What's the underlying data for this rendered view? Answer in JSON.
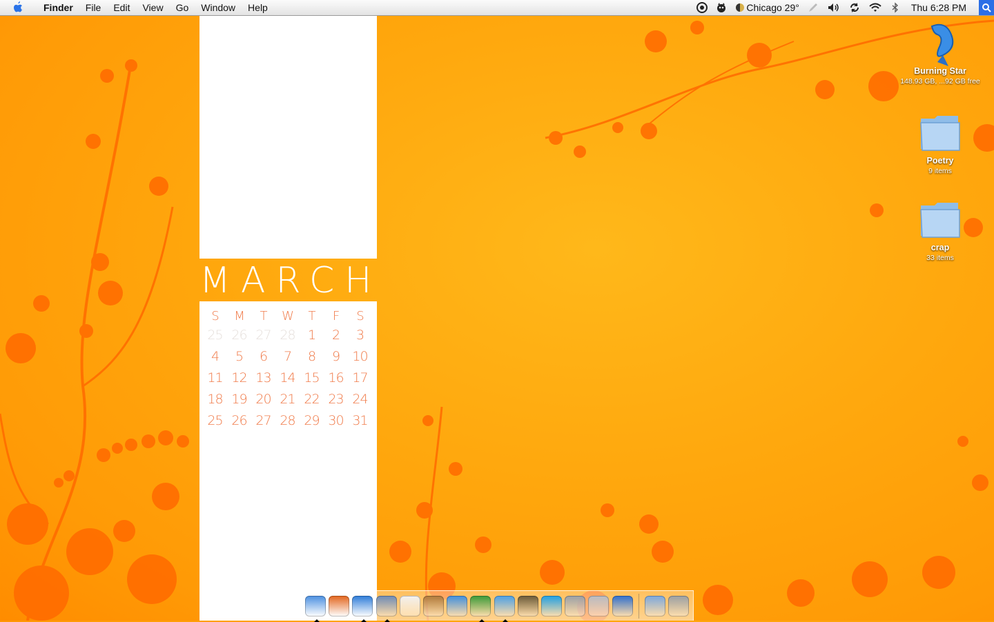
{
  "menubar": {
    "apple_icon": "apple-icon",
    "app_name": "Finder",
    "menus": [
      "File",
      "Edit",
      "View",
      "Go",
      "Window",
      "Help"
    ],
    "status": {
      "weather": "Chicago 29°",
      "clock": "Thu 6:28 PM",
      "icons": [
        "quicksilver-icon",
        "growl-icon",
        "weather-icon",
        "pen-icon",
        "volume-icon",
        "sync-icon",
        "wifi-icon",
        "bluetooth-icon",
        "spotlight-icon"
      ]
    }
  },
  "calendar": {
    "month": "MARCH",
    "weekdays": [
      "S",
      "M",
      "T",
      "W",
      "T",
      "F",
      "S"
    ],
    "weeks": [
      [
        "25",
        "26",
        "27",
        "28",
        "1",
        "2",
        "3"
      ],
      [
        "4",
        "5",
        "6",
        "7",
        "8",
        "9",
        "10"
      ],
      [
        "11",
        "12",
        "13",
        "14",
        "15",
        "16",
        "17"
      ],
      [
        "18",
        "19",
        "20",
        "21",
        "22",
        "23",
        "24"
      ],
      [
        "25",
        "26",
        "27",
        "28",
        "29",
        "30",
        "31"
      ]
    ],
    "muted_count_first_week": 4
  },
  "desktop_icons": [
    {
      "name": "Burning Star",
      "sub": "148.93 GB, ...92 GB free",
      "icon": "hard-drive-icon"
    },
    {
      "name": "Poetry",
      "sub": "9 items",
      "icon": "folder-icon"
    },
    {
      "name": "crap",
      "sub": "33 items",
      "icon": "folder-icon"
    }
  ],
  "dock": {
    "items": [
      {
        "icon": "finder-icon",
        "running": true,
        "color": "#4a8fe0"
      },
      {
        "icon": "burning-tree-icon",
        "running": false,
        "color": "#e2641c"
      },
      {
        "icon": "safari-icon",
        "running": true,
        "color": "#2c7bd8"
      },
      {
        "icon": "preview-icon",
        "running": true,
        "color": "#6c8bb8"
      },
      {
        "icon": "ical-icon",
        "running": false,
        "color": "#f2f2f2"
      },
      {
        "icon": "address-book-icon",
        "running": false,
        "color": "#b07a3c"
      },
      {
        "icon": "ichat-icon",
        "running": false,
        "color": "#3f8fe0"
      },
      {
        "icon": "adium-icon",
        "running": true,
        "color": "#3a9a3a"
      },
      {
        "icon": "itunes-icon",
        "running": true,
        "color": "#4aa0e8"
      },
      {
        "icon": "iphoto-icon",
        "running": false,
        "color": "#6a5a3a"
      },
      {
        "icon": "skype-icon",
        "running": false,
        "color": "#1ea0e6"
      },
      {
        "icon": "package-icon",
        "running": false,
        "color": "#9aa0a8"
      },
      {
        "icon": "system-preferences-icon",
        "running": false,
        "color": "#b8bcc4"
      },
      {
        "icon": "word-icon",
        "running": false,
        "color": "#2e6fd0"
      }
    ],
    "trailing": [
      {
        "icon": "applications-folder-icon",
        "color": "#7aa8e0"
      },
      {
        "icon": "trash-icon",
        "color": "#9aa0a6"
      }
    ]
  }
}
